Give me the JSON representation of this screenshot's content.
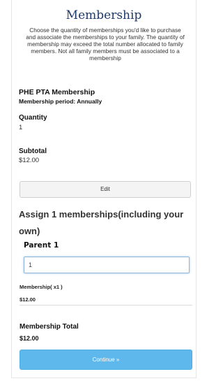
{
  "header": {
    "title": "Membership",
    "intro": "Choose the quantity of memberships you'd like to purchase and associate the memberships to your family. The quantity of membership may exceed the total number allocated to family members. Not all family members must be associated to a membership"
  },
  "product": {
    "name": "PHE PTA Membership",
    "period": "Membership period: Annually",
    "quantity_label": "Quantity",
    "quantity_value": "1",
    "subtotal_label": "Subtotal",
    "subtotal_value": "$12.00"
  },
  "actions": {
    "edit_label": "Edit",
    "continue_label": "Continue »"
  },
  "assign": {
    "heading": "Assign 1 memberships(including your own)",
    "members": [
      {
        "label": "Parent 1",
        "value": "1"
      }
    ]
  },
  "summary": {
    "line_label": "Membership( x1 )",
    "line_price": "$12.00",
    "total_label": "Membership Total",
    "total_value": "$12.00"
  },
  "colors": {
    "title": "#1e3a6a",
    "continue_button": "#5fb8ec",
    "input_focus_border": "#8fb6d8"
  }
}
